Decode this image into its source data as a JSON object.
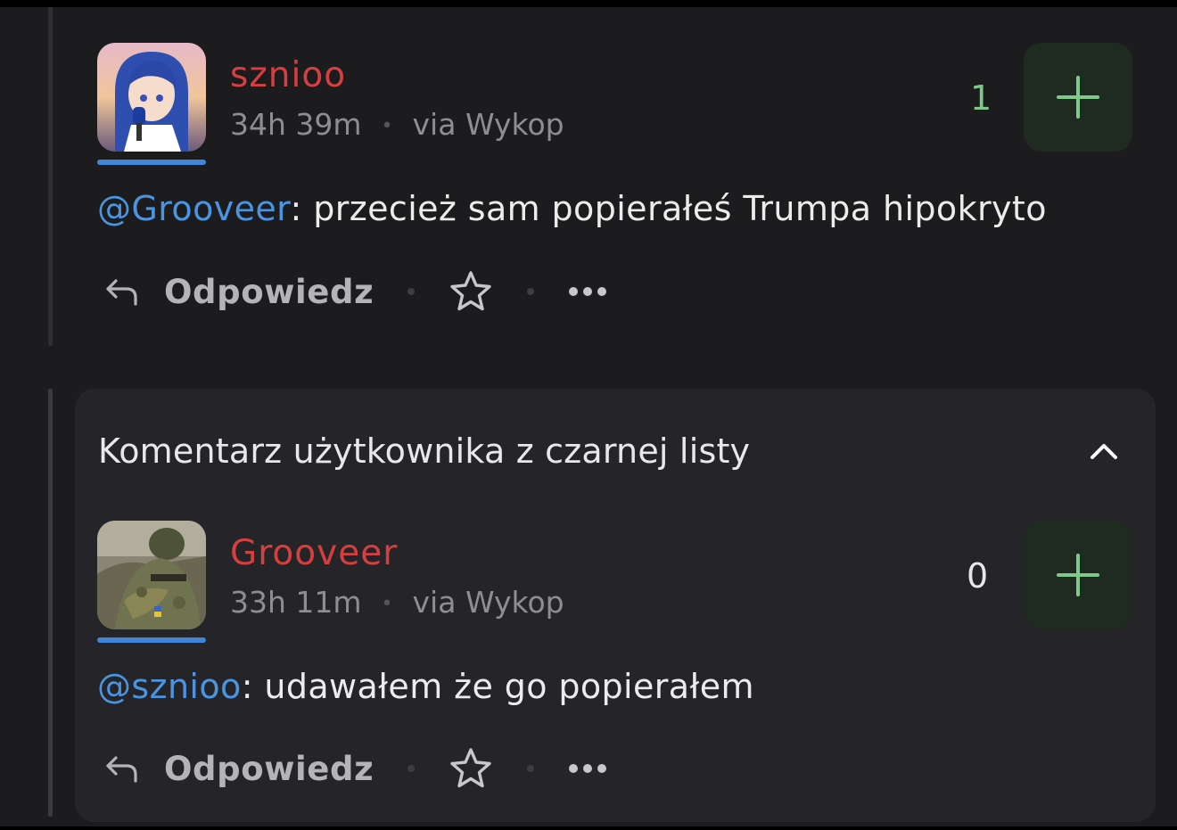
{
  "comments": [
    {
      "username": "sznioo",
      "time": "34h 39m",
      "via": "via Wykop",
      "votes": "1",
      "mention": "@Grooveer",
      "text": ": przecież sam popierałeś Trumpa hipokryto",
      "reply_label": "Odpowiedz"
    },
    {
      "username": "Grooveer",
      "time": "33h 11m",
      "via": "via Wykop",
      "votes": "0",
      "mention": "@sznioo",
      "text": ": udawałem że go popierałem",
      "reply_label": "Odpowiedz"
    }
  ],
  "blocked": {
    "title": "Komentarz użytkownika z czarnej listy"
  },
  "colors": {
    "username": "#d63f3f",
    "mention": "#4a94e0",
    "vote_positive": "#7ec98a",
    "plus": "#7ec98a",
    "avatar_underline": "#3f86d9"
  },
  "icons": [
    "reply-icon",
    "star-icon",
    "more-icon",
    "plus-icon",
    "chevron-up-icon"
  ]
}
